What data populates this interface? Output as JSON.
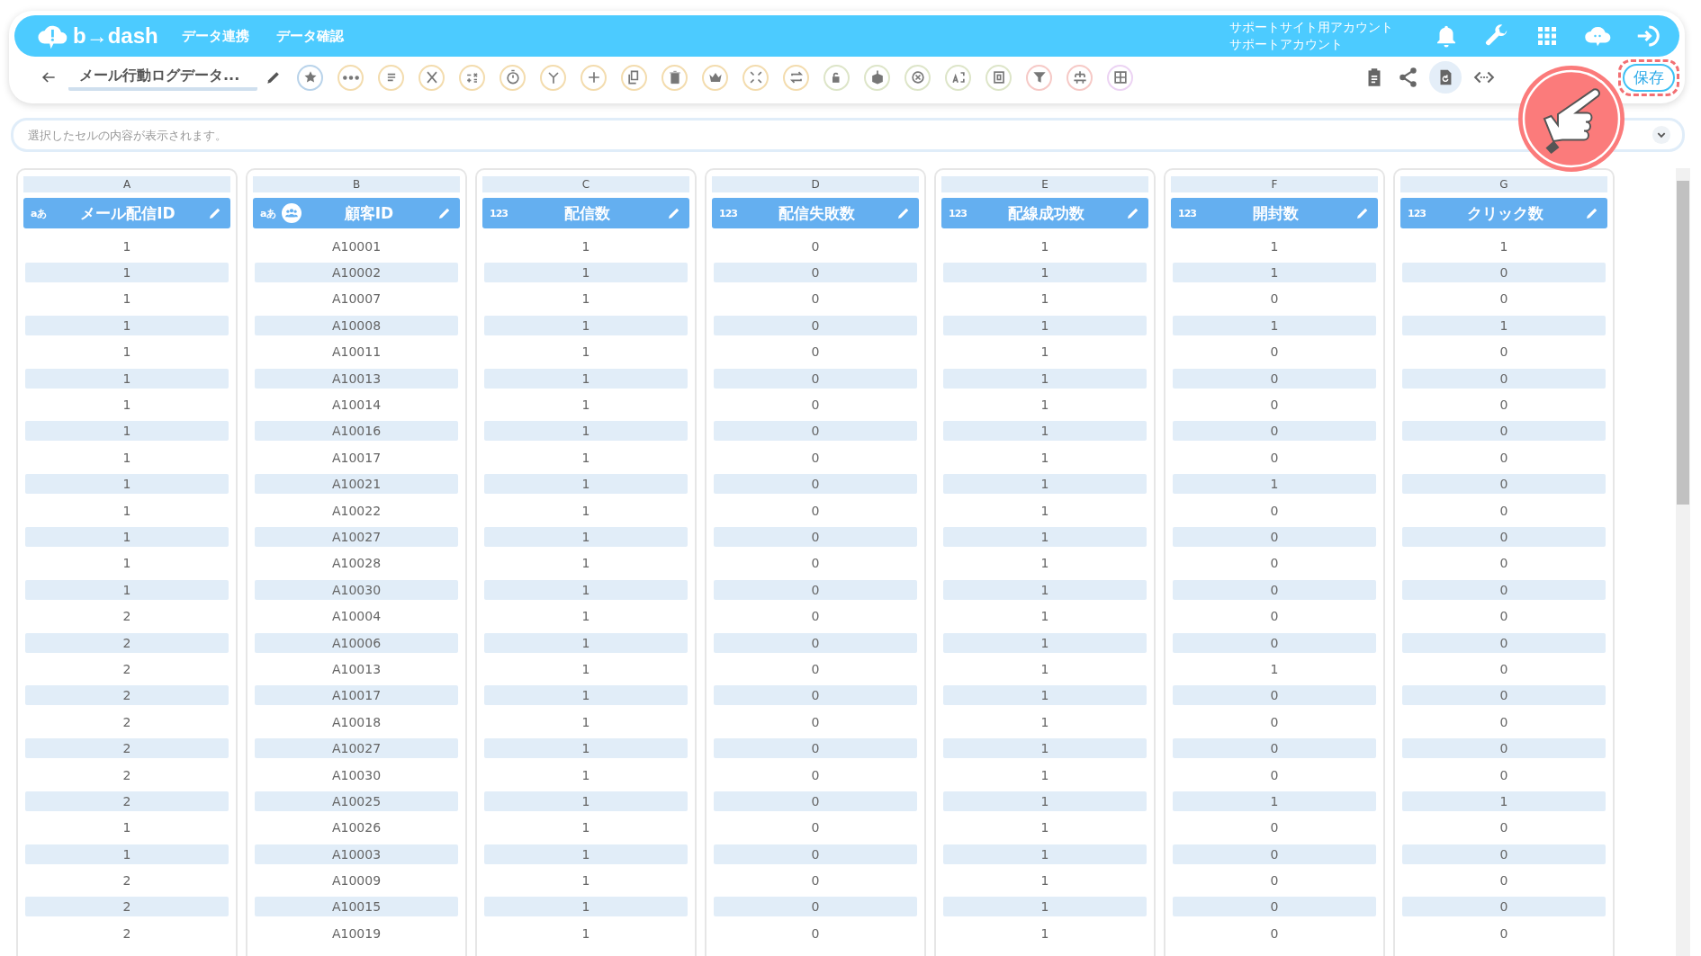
{
  "header": {
    "logo": "b→dash",
    "nav": [
      {
        "label": "データ連携"
      },
      {
        "label": "データ確認"
      }
    ],
    "account": [
      "サポートサイト用アカウント",
      "サポートアカウント"
    ]
  },
  "toolbar": {
    "title": "メール行動ログデータ...",
    "save": "保存"
  },
  "formula_bar": {
    "placeholder": "選択したセルの内容が表示されます。"
  },
  "columns": [
    {
      "letter": "A",
      "name": "メール配信ID",
      "kind": "text",
      "type_label": "aあ",
      "customer_key": false
    },
    {
      "letter": "B",
      "name": "顧客ID",
      "kind": "text",
      "type_label": "aあ",
      "customer_key": true
    },
    {
      "letter": "C",
      "name": "配信数",
      "kind": "number",
      "type_label": "123",
      "customer_key": false
    },
    {
      "letter": "D",
      "name": "配信失敗数",
      "kind": "number",
      "type_label": "123",
      "customer_key": false
    },
    {
      "letter": "E",
      "name": "配線成功数",
      "kind": "number",
      "type_label": "123",
      "customer_key": false
    },
    {
      "letter": "F",
      "name": "開封数",
      "kind": "number",
      "type_label": "123",
      "customer_key": false
    },
    {
      "letter": "G",
      "name": "クリック数",
      "kind": "number",
      "type_label": "123",
      "customer_key": false
    }
  ],
  "rows": [
    [
      "1",
      "A10001",
      "1",
      "0",
      "1",
      "1",
      "1"
    ],
    [
      "1",
      "A10002",
      "1",
      "0",
      "1",
      "1",
      "0"
    ],
    [
      "1",
      "A10007",
      "1",
      "0",
      "1",
      "0",
      "0"
    ],
    [
      "1",
      "A10008",
      "1",
      "0",
      "1",
      "1",
      "1"
    ],
    [
      "1",
      "A10011",
      "1",
      "0",
      "1",
      "0",
      "0"
    ],
    [
      "1",
      "A10013",
      "1",
      "0",
      "1",
      "0",
      "0"
    ],
    [
      "1",
      "A10014",
      "1",
      "0",
      "1",
      "0",
      "0"
    ],
    [
      "1",
      "A10016",
      "1",
      "0",
      "1",
      "0",
      "0"
    ],
    [
      "1",
      "A10017",
      "1",
      "0",
      "1",
      "0",
      "0"
    ],
    [
      "1",
      "A10021",
      "1",
      "0",
      "1",
      "1",
      "0"
    ],
    [
      "1",
      "A10022",
      "1",
      "0",
      "1",
      "0",
      "0"
    ],
    [
      "1",
      "A10027",
      "1",
      "0",
      "1",
      "0",
      "0"
    ],
    [
      "1",
      "A10028",
      "1",
      "0",
      "1",
      "0",
      "0"
    ],
    [
      "1",
      "A10030",
      "1",
      "0",
      "1",
      "0",
      "0"
    ],
    [
      "2",
      "A10004",
      "1",
      "0",
      "1",
      "0",
      "0"
    ],
    [
      "2",
      "A10006",
      "1",
      "0",
      "1",
      "0",
      "0"
    ],
    [
      "2",
      "A10013",
      "1",
      "0",
      "1",
      "1",
      "0"
    ],
    [
      "2",
      "A10017",
      "1",
      "0",
      "1",
      "0",
      "0"
    ],
    [
      "2",
      "A10018",
      "1",
      "0",
      "1",
      "0",
      "0"
    ],
    [
      "2",
      "A10027",
      "1",
      "0",
      "1",
      "0",
      "0"
    ],
    [
      "2",
      "A10030",
      "1",
      "0",
      "1",
      "0",
      "0"
    ],
    [
      "2",
      "A10025",
      "1",
      "0",
      "1",
      "1",
      "1"
    ],
    [
      "1",
      "A10026",
      "1",
      "0",
      "1",
      "0",
      "0"
    ],
    [
      "1",
      "A10003",
      "1",
      "0",
      "1",
      "0",
      "0"
    ],
    [
      "2",
      "A10009",
      "1",
      "0",
      "1",
      "0",
      "0"
    ],
    [
      "2",
      "A10015",
      "1",
      "0",
      "1",
      "0",
      "0"
    ],
    [
      "2",
      "A10019",
      "1",
      "0",
      "1",
      "0",
      "0"
    ]
  ]
}
